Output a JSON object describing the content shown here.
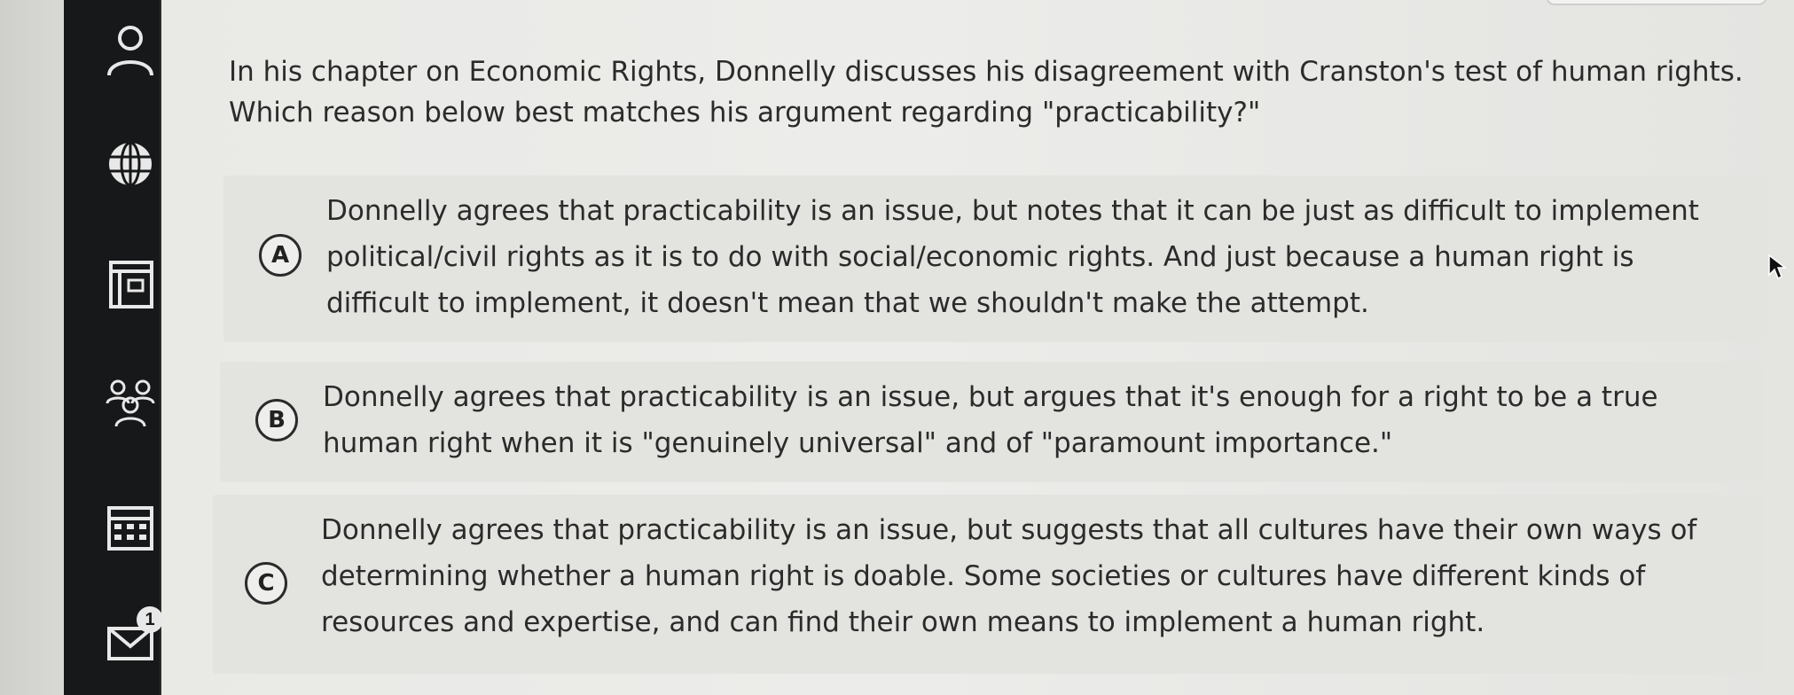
{
  "question": {
    "text_line1": "In his chapter on Economic Rights, Donnelly discusses his disagreement with Cranston's test of human rights.",
    "text_line2": "Which reason below best matches his argument regarding \"practicability?\""
  },
  "options": [
    {
      "letter": "A",
      "line1": "Donnelly agrees that practicability is an issue, but notes that it can be just as difficult to implement",
      "line2": "political/civil rights as it is to do with social/economic rights. And just because a human right is",
      "line3": "difficult to implement, it doesn't mean that we shouldn't make the attempt."
    },
    {
      "letter": "B",
      "line1": "Donnelly agrees that practicability is an issue, but argues that it's enough for a right to be a true",
      "line2": "human right when it is \"genuinely universal\" and of \"paramount importance.\""
    },
    {
      "letter": "C",
      "line1": "Donnelly agrees that practicability is an issue, but suggests that all cultures have their own ways of",
      "line2": "determining whether a human right is doable. Some societies or cultures have different kinds of",
      "line3": "resources and expertise, and can find their own means to implement a human right."
    }
  ],
  "sidebar": {
    "items": [
      {
        "icon": "user-icon"
      },
      {
        "icon": "globe-icon"
      },
      {
        "icon": "document-icon"
      },
      {
        "icon": "group-icon"
      },
      {
        "icon": "calendar-icon"
      },
      {
        "icon": "mail-icon",
        "badge": "1"
      }
    ]
  },
  "colors": {
    "sidebar_bg": "#17181a",
    "option_bg": "#e3e3e0",
    "page_bg": "#ececea"
  }
}
